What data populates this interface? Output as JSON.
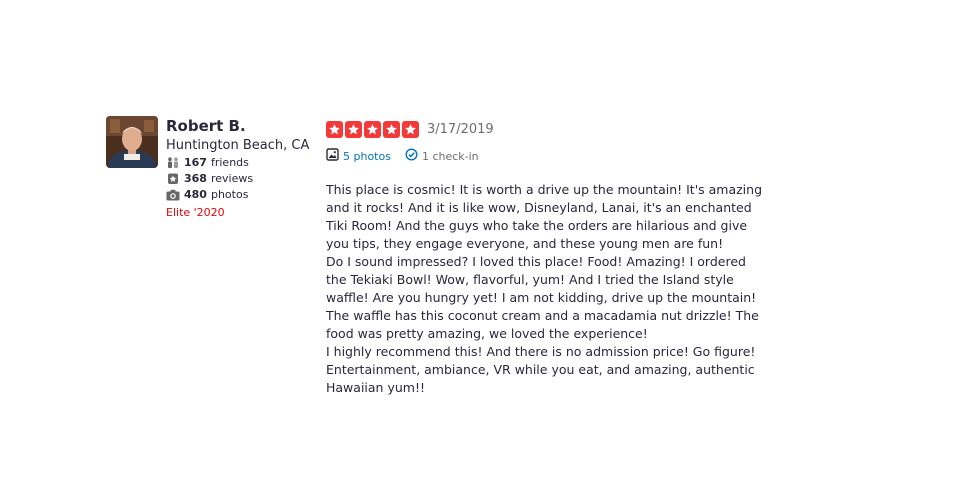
{
  "user": {
    "name": "Robert B.",
    "location": "Huntington Beach, CA",
    "friends_count": "167",
    "friends_label": "friends",
    "reviews_count": "368",
    "reviews_label": "reviews",
    "photos_count": "480",
    "photos_label": "photos",
    "elite": "Elite '2020"
  },
  "review": {
    "rating": 5,
    "date": "3/17/2019",
    "photos_link": "5 photos",
    "checkins": "1 check-in",
    "lines": [
      "This place is cosmic!  It is worth a drive up  the mountain!  It's amazing",
      "and it rocks!   And it is like wow, Disneyland, Lanai, it's an enchanted",
      "Tiki Room!  And the guys who take the orders are hilarious and give",
      "you tips, they engage everyone, and these young men are fun!",
      "Do I sound impressed?  I loved this place!  Food!  Amazing!  I ordered",
      "the Tekiaki Bowl!  Wow, flavorful, yum!  And I tried the Island style",
      "waffle! Are you hungry yet!  I am not kidding, drive up the mountain!",
      " The waffle has this coconut cream and a macadamia nut drizzle!   The",
      "food was pretty amazing, we loved the experience!",
      "I highly recommend this!  And there is no admission price!  Go figure!",
      " Entertainment, ambiance, VR while you eat, and amazing, authentic",
      "Hawaiian yum!!"
    ]
  },
  "colors": {
    "star": "#f43939",
    "link": "#0073bb",
    "elite": "#e00707",
    "text": "#2b273c"
  }
}
